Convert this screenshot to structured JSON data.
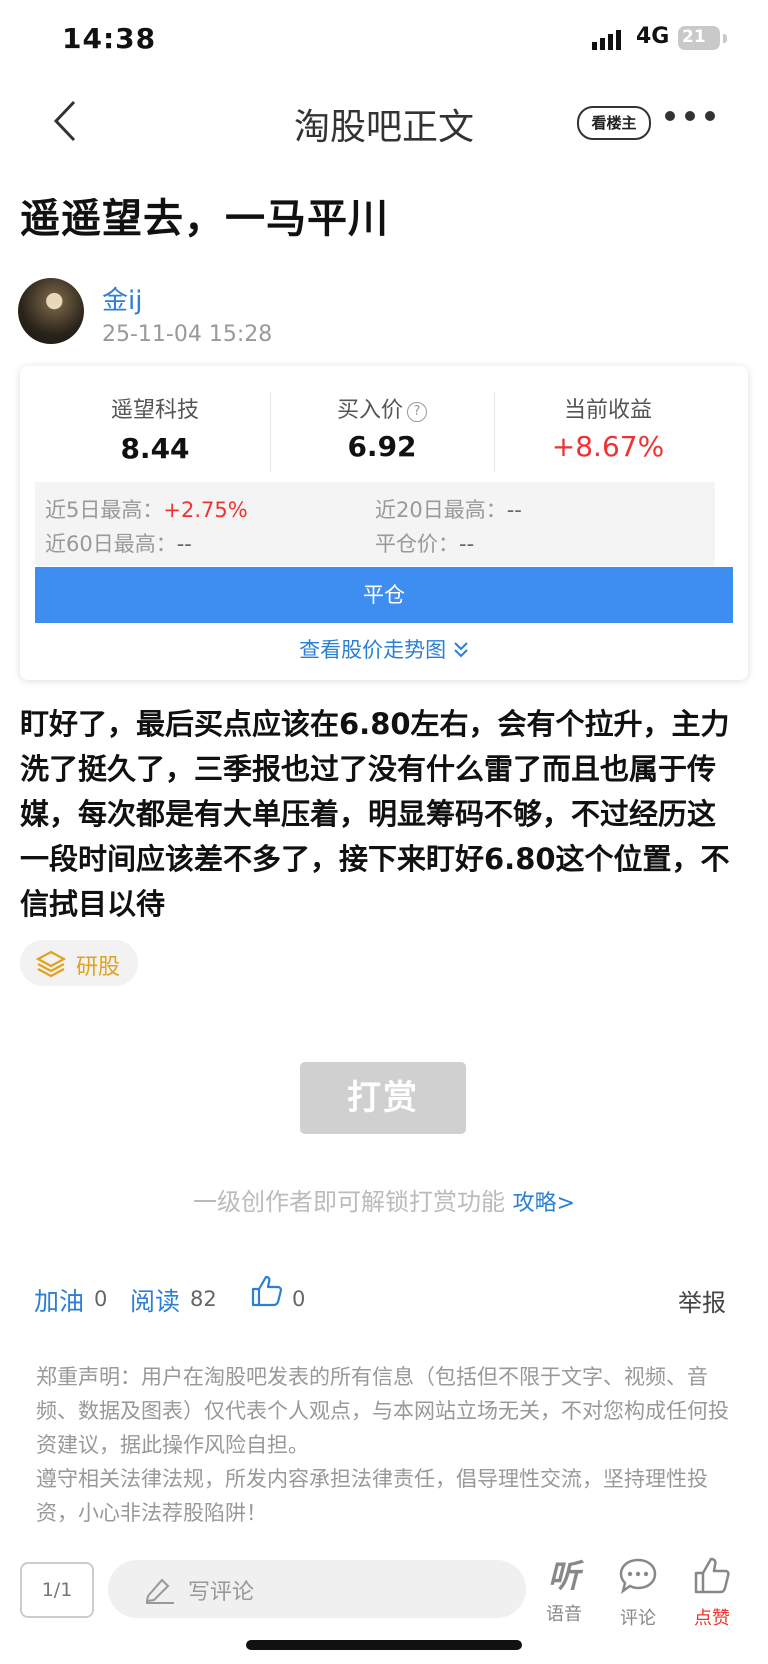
{
  "status_bar": {
    "time": "14:38",
    "network": "4G",
    "battery": "21"
  },
  "nav": {
    "title": "淘股吧正文",
    "author_only_label": "看楼主"
  },
  "post": {
    "title": "遥遥望去，一马平川",
    "author": "金ij",
    "time": "25-11-04 15:28",
    "body": "盯好了，最后买点应该在6.80左右，会有个拉升，主力洗了挺久了，三季报也过了没有什么雷了而且也属于传媒，每次都是有大单压着，明显筹码不够，不过经历这一段时间应该差不多了，接下来盯好6.80这个位置，不信拭目以待",
    "tag": "研股"
  },
  "trade_card": {
    "stock_name": "遥望科技",
    "stock_price": "8.44",
    "buy_price_label": "买入价",
    "buy_price": "6.92",
    "return_label": "当前收益",
    "return_value": "+8.67%",
    "high5_label": "近5日最高：",
    "high5_value": "+2.75%",
    "high20_label": "近20日最高：",
    "high20_value": "--",
    "high60_label": "近60日最高：",
    "high60_value": "--",
    "close_price_label": "平仓价：",
    "close_price_value": "--",
    "close_button": "平仓",
    "trend_link": "查看股价走势图"
  },
  "reward": {
    "button": "打赏",
    "tip": "一级创作者即可解锁打赏功能",
    "guide_link": "攻略>"
  },
  "stats": {
    "cheer_label": "加油",
    "cheer_count": "0",
    "read_label": "阅读",
    "read_count": "82",
    "like_count": "0",
    "report_label": "举报"
  },
  "disclaimer": {
    "line1": "郑重声明：用户在淘股吧发表的所有信息（包括但不限于文字、视频、音频、数据及图表）仅代表个人观点，与本网站立场无关，不对您构成任何投资建议，据此操作风险自担。",
    "line2": "遵守相关法律法规，所发内容承担法律责任，倡导理性交流，坚持理性投资，小心非法荐股陷阱！"
  },
  "bottom_bar": {
    "page_indicator": "1/1",
    "comment_placeholder": "写评论",
    "voice_label": "语音",
    "comment_label": "评论",
    "like_label": "点赞"
  },
  "colors": {
    "accent_blue": "#2b7fd6",
    "button_blue": "#3d8ef0",
    "gain_red": "#e33333"
  }
}
